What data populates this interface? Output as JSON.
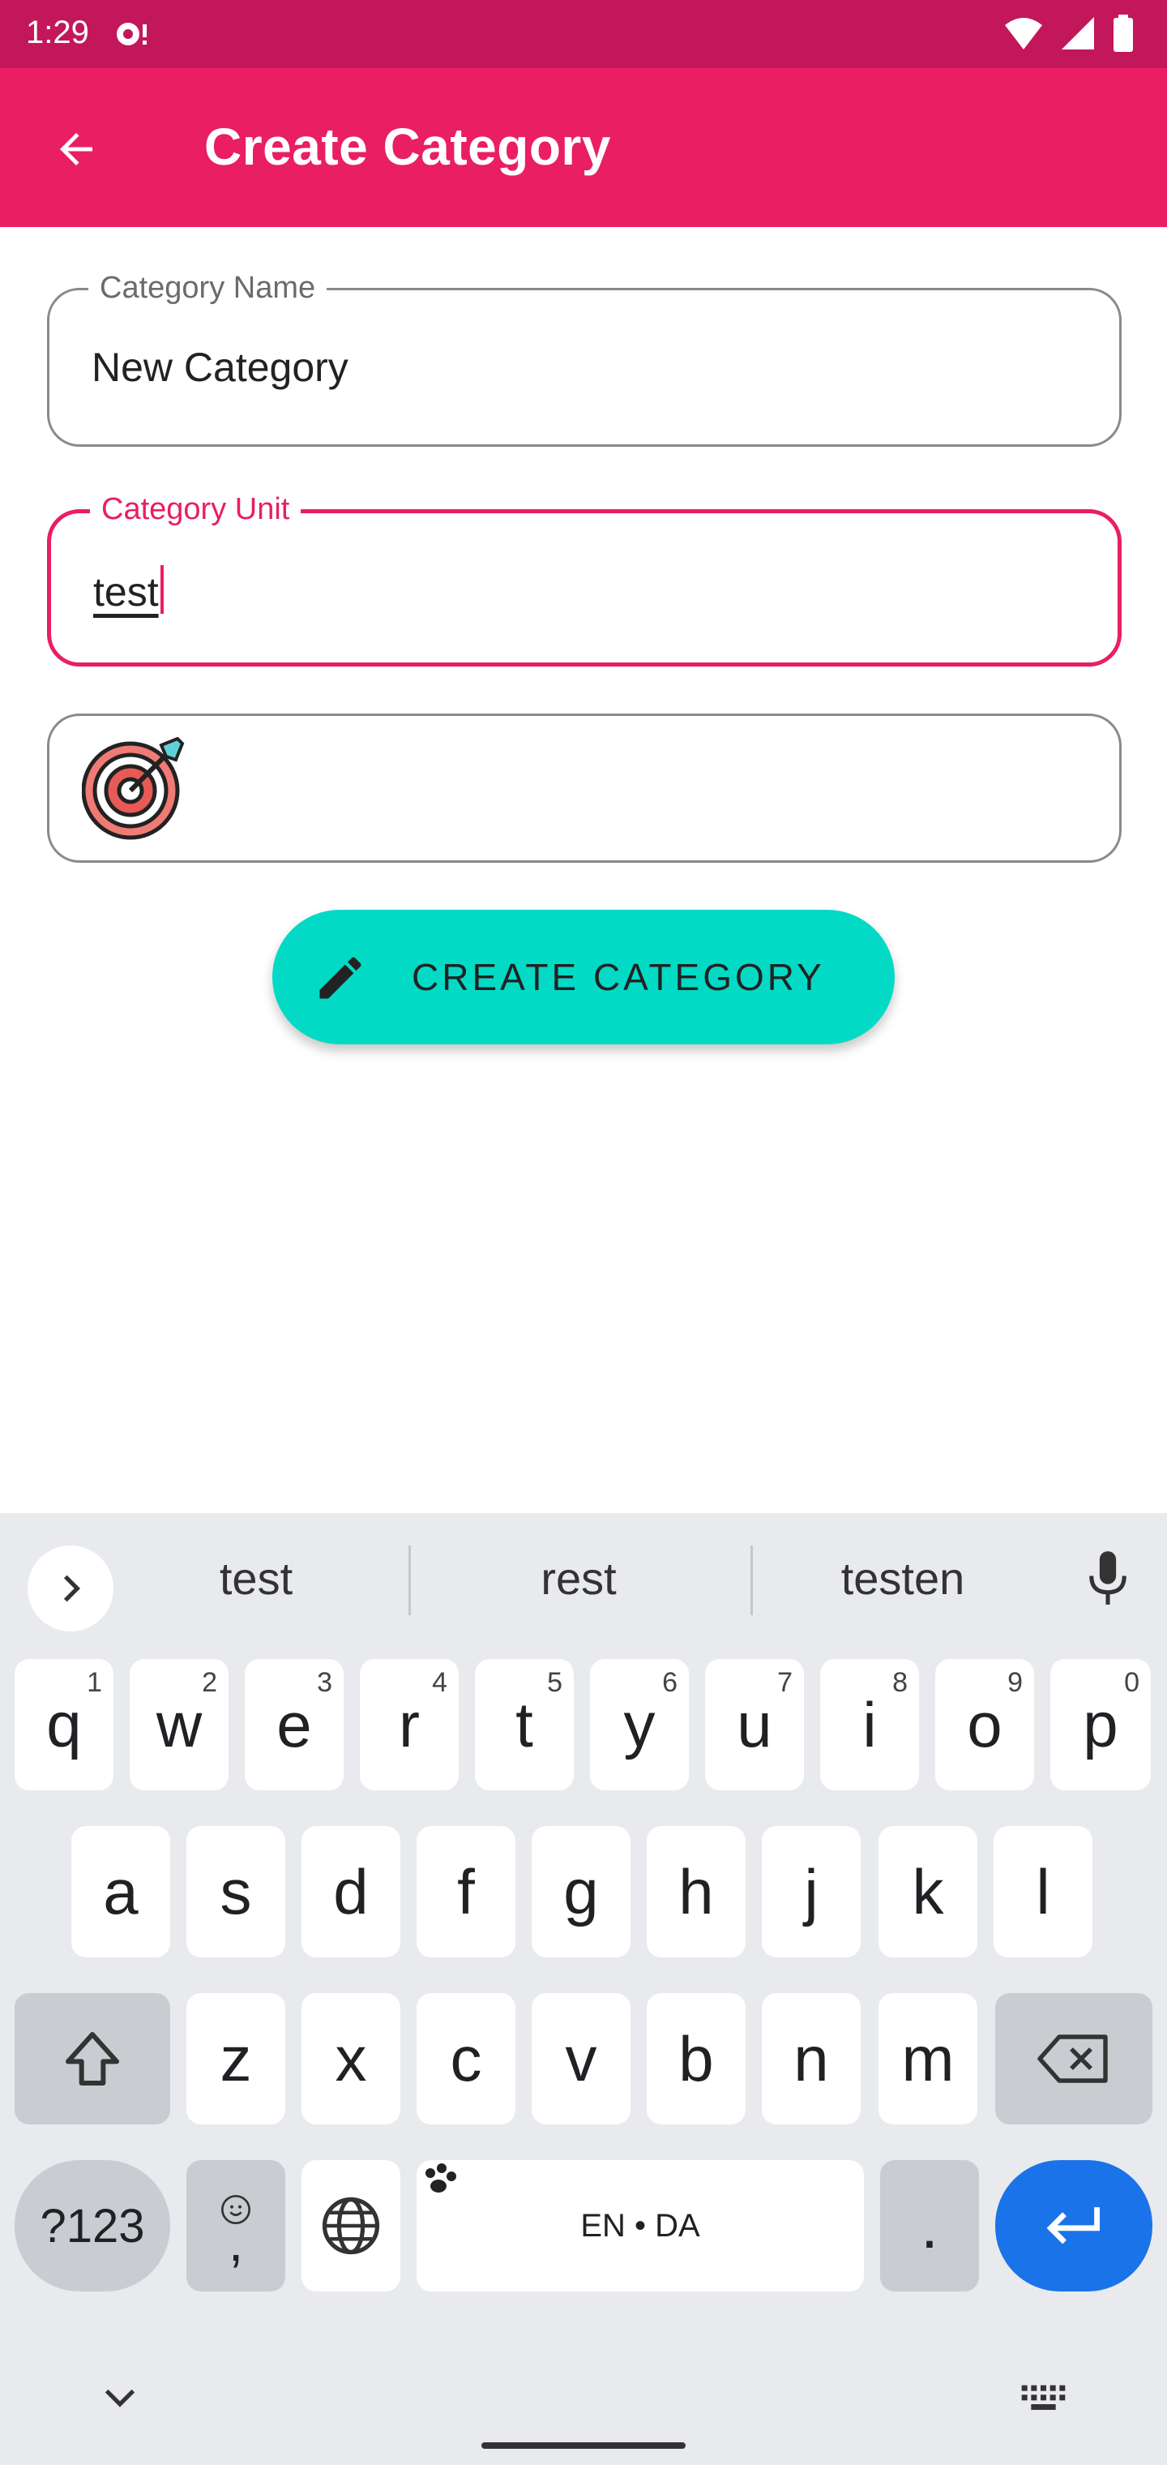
{
  "status_bar": {
    "time": "1:29"
  },
  "app_bar": {
    "title": "Create Category",
    "back_icon": "arrow-left-icon"
  },
  "form": {
    "name_label": "Category Name",
    "name_value": "New Category",
    "unit_label": "Category Unit",
    "unit_value": "test",
    "icon_name": "target-dart-icon",
    "create_label": "CREATE CATEGORY"
  },
  "colors": {
    "primary": "#e91e63",
    "primary_dark": "#c2185b",
    "accent": "#03dac6",
    "enter_key": "#1a73e8"
  },
  "keyboard": {
    "suggestions": [
      "test",
      "rest",
      "testen"
    ],
    "row1": [
      {
        "k": "q",
        "h": "1"
      },
      {
        "k": "w",
        "h": "2"
      },
      {
        "k": "e",
        "h": "3"
      },
      {
        "k": "r",
        "h": "4"
      },
      {
        "k": "t",
        "h": "5"
      },
      {
        "k": "y",
        "h": "6"
      },
      {
        "k": "u",
        "h": "7"
      },
      {
        "k": "i",
        "h": "8"
      },
      {
        "k": "o",
        "h": "9"
      },
      {
        "k": "p",
        "h": "0"
      }
    ],
    "row2": [
      "a",
      "s",
      "d",
      "f",
      "g",
      "h",
      "j",
      "k",
      "l"
    ],
    "row3": [
      "z",
      "x",
      "c",
      "v",
      "b",
      "n",
      "m"
    ],
    "symbols_label": "?123",
    "comma_label": ",",
    "space_label": "EN • DA",
    "period_label": "."
  }
}
